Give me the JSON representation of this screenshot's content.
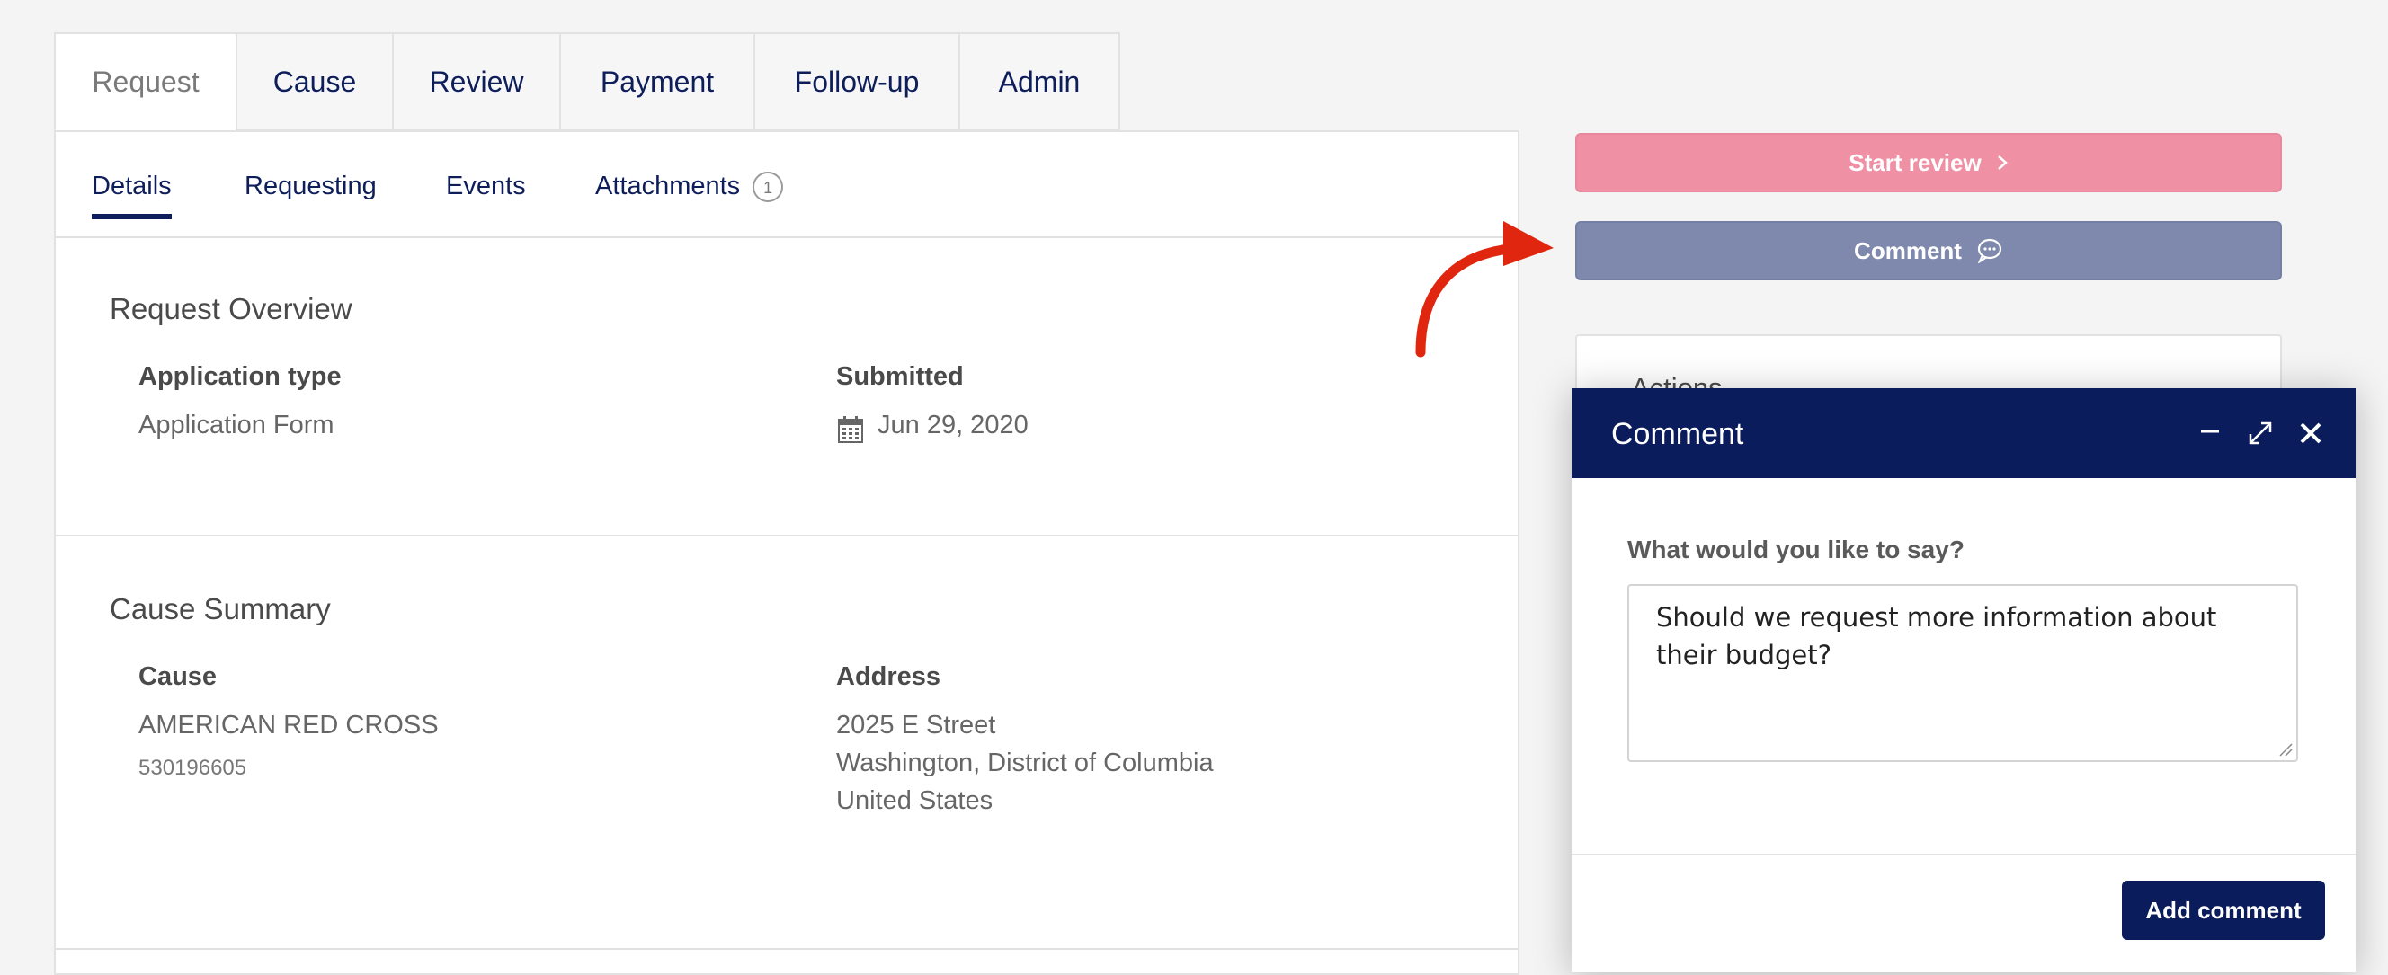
{
  "top_tabs": [
    "Request",
    "Cause",
    "Review",
    "Payment",
    "Follow-up",
    "Admin"
  ],
  "sub_tabs": {
    "details": "Details",
    "requesting": "Requesting",
    "events": "Events",
    "attachments": "Attachments",
    "attachments_count": "1"
  },
  "request_overview": {
    "title": "Request Overview",
    "application_type_label": "Application type",
    "application_type_value": "Application Form",
    "submitted_label": "Submitted",
    "submitted_value": "Jun 29, 2020"
  },
  "cause_summary": {
    "title": "Cause Summary",
    "cause_label": "Cause",
    "cause_name": "AMERICAN RED CROSS",
    "cause_id": "530196605",
    "address_label": "Address",
    "address_line1": "2025 E Street",
    "address_line2": "Washington, District of Columbia",
    "address_line3": "United States"
  },
  "side": {
    "start_review_label": "Start review",
    "comment_label": "Comment",
    "actions_title": "Actions"
  },
  "modal": {
    "title": "Comment",
    "question": "What would you like to say?",
    "comment_text": "Should we request more information about their budget?",
    "submit_label": "Add comment"
  },
  "colors": {
    "brand_navy": "#0b1c5c",
    "start_review": "#ef90a5",
    "comment_button": "#7e89ad",
    "arrow": "#e0260f"
  }
}
